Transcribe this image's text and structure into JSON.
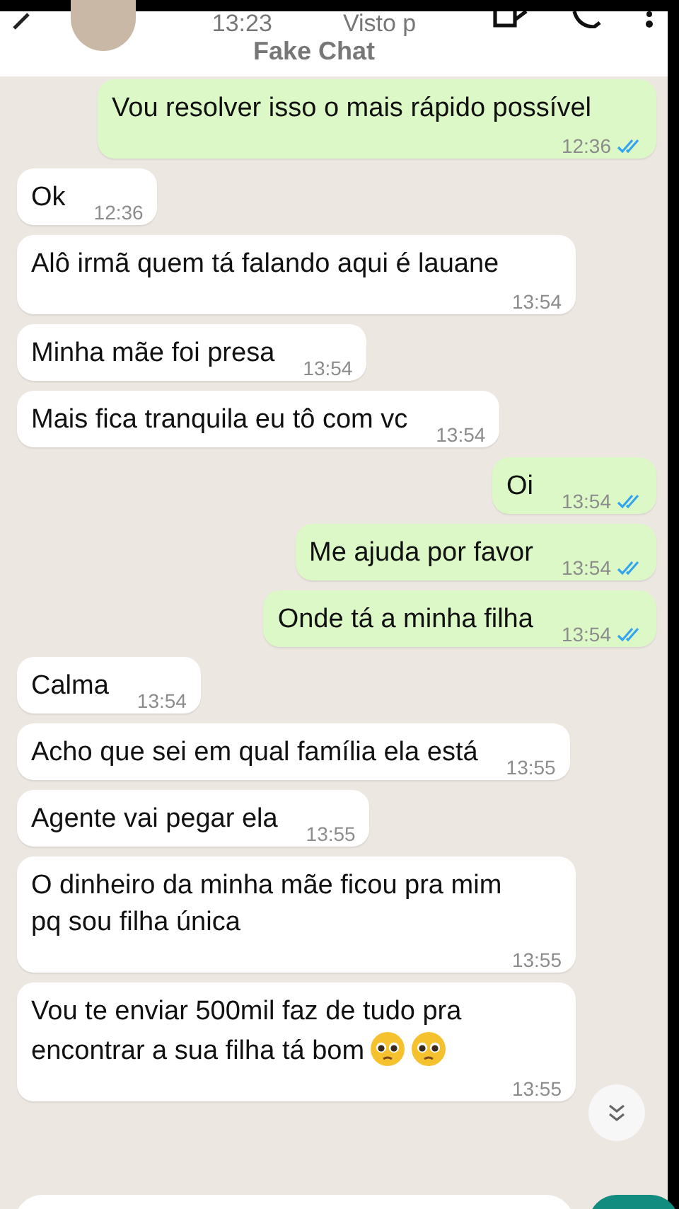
{
  "header": {
    "last_seen_time": "13:23",
    "status": "Visto p",
    "app_label": "Fake Chat"
  },
  "messages": [
    {
      "text": "Vou resolver isso o mais rápido possível",
      "time": "12:36",
      "outgoing": true,
      "read": true
    },
    {
      "text": "Ok",
      "time": "12:36",
      "outgoing": false
    },
    {
      "text": "Alô irmã quem tá falando aqui é lauane",
      "time": "13:54",
      "outgoing": false
    },
    {
      "text": "Minha mãe foi presa",
      "time": "13:54",
      "outgoing": false
    },
    {
      "text": "Mais fica tranquila eu tô com vc",
      "time": "13:54",
      "outgoing": false
    },
    {
      "text": "Oi",
      "time": "13:54",
      "outgoing": true,
      "read": true
    },
    {
      "text": "Me ajuda por favor",
      "time": "13:54",
      "outgoing": true,
      "read": true
    },
    {
      "text": "Onde tá a minha filha",
      "time": "13:54",
      "outgoing": true,
      "read": true
    },
    {
      "text": "Calma",
      "time": "13:54",
      "outgoing": false
    },
    {
      "text": "Acho que sei em qual família ela está",
      "time": "13:55",
      "outgoing": false
    },
    {
      "text": "Agente vai pegar ela",
      "time": "13:55",
      "outgoing": false
    },
    {
      "text": "O dinheiro da minha mãe ficou pra mim pq sou filha única",
      "time": "13:55",
      "outgoing": false
    },
    {
      "text": "Vou te enviar 500mil faz de tudo pra encontrar a sua filha tá bom",
      "time": "13:55",
      "outgoing": false,
      "kind": "emoji"
    }
  ]
}
